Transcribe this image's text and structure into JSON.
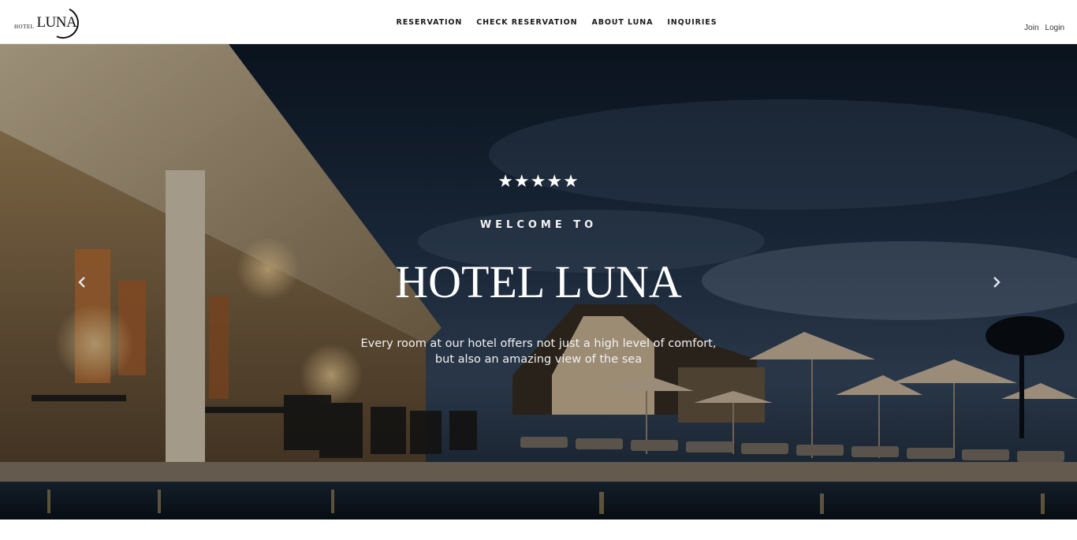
{
  "logo": {
    "small": "HOTEL",
    "big": "LUNA"
  },
  "nav": {
    "items": [
      {
        "label": "RESERVATION"
      },
      {
        "label": "CHECK RESERVATION"
      },
      {
        "label": "ABOUT LUNA"
      },
      {
        "label": "INQUIRIES"
      }
    ]
  },
  "auth": {
    "join": "Join",
    "login": "Login"
  },
  "hero": {
    "rating_stars": "★★★★★",
    "rating": 5,
    "welcome": "WELCOME TO",
    "title": "HOTEL LUNA",
    "tagline_line1": "Every room at our hotel offers not just a high level of comfort,",
    "tagline_line2": "but also an amazing view of the sea",
    "prev_icon": "chevron-left-icon",
    "next_icon": "chevron-right-icon"
  },
  "colors": {
    "header_bg": "#ffffff",
    "nav_text": "#1a1a1a",
    "hero_overlay": "#0c1520"
  }
}
